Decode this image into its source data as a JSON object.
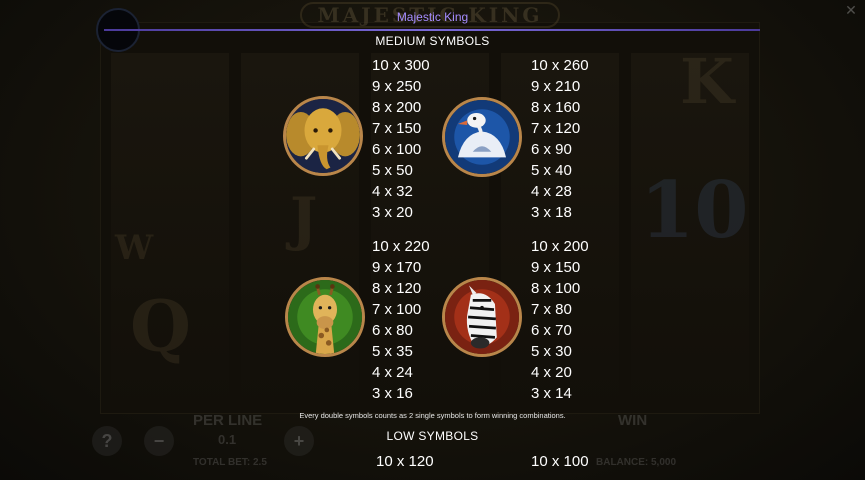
{
  "header": {
    "title": "Majestic King"
  },
  "sections": {
    "medium": {
      "title": "MEDIUM SYMBOLS"
    },
    "low": {
      "title": "LOW SYMBOLS"
    }
  },
  "note": "Every double symbols counts as 2 single symbols to form winning combinations.",
  "paytable": {
    "medium": [
      {
        "symbol": "elephant-icon",
        "payouts": [
          "10 x 300",
          "9 x 250",
          "8 x 200",
          "7 x 150",
          "6 x 100",
          "5 x 50",
          "4 x 32",
          "3 x 20"
        ]
      },
      {
        "symbol": "vulture-icon",
        "payouts": [
          "10 x 260",
          "9 x 210",
          "8 x 160",
          "7 x 120",
          "6 x 90",
          "5 x 40",
          "4 x 28",
          "3 x 18"
        ]
      },
      {
        "symbol": "giraffe-icon",
        "payouts": [
          "10 x 220",
          "9 x 170",
          "8 x 120",
          "7 x 100",
          "6 x 80",
          "5 x 35",
          "4 x 24",
          "3 x 16"
        ]
      },
      {
        "symbol": "zebra-icon",
        "payouts": [
          "10 x 200",
          "9 x 150",
          "8 x 100",
          "7 x 80",
          "6 x 70",
          "5 x 30",
          "4 x 20",
          "3 x 14"
        ]
      }
    ],
    "low": [
      {
        "payouts": [
          "10 x 120"
        ]
      },
      {
        "payouts": [
          "10 x 100"
        ]
      }
    ]
  },
  "background": {
    "game_logo": "MAJESTIC KING",
    "per_line_label": "PER LINE",
    "per_line_value": "0.1",
    "win_label": "WIN",
    "total_bet": "TOTAL BET: 2.5",
    "balance": "BALANCE: 5,000"
  },
  "colors": {
    "accent": "#a58cff",
    "frame": "#b9864a",
    "background": "#0a0906"
  }
}
